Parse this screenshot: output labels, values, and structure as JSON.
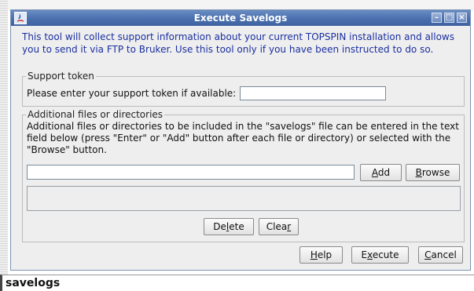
{
  "window": {
    "title": "Execute Savelogs",
    "minimize_icon": "minimize-icon",
    "maximize_icon": "maximize-icon",
    "close_icon": "close-icon"
  },
  "intro_text": "This tool will collect support information about your current TOPSPIN installation and allows you to send it via FTP to Bruker. Use this tool only if you have been instructed to do so.",
  "support_token": {
    "legend": "Support token",
    "label": "Please enter your support token if available:",
    "value": ""
  },
  "additional": {
    "legend": "Additional files or directories",
    "description": "Additional files or directories to be included in the \"savelogs\" file can be entered in the text field below (press \"Enter\" or \"Add\" button after each file or directory) or selected with the \"Browse\" button.",
    "path_value": "",
    "add": {
      "pre": "",
      "mn": "A",
      "post": "dd"
    },
    "browse": {
      "pre": "",
      "mn": "B",
      "post": "rowse"
    },
    "delete": {
      "pre": "De",
      "mn": "l",
      "post": "ete"
    },
    "clear": {
      "pre": "Clea",
      "mn": "r",
      "post": ""
    }
  },
  "footer": {
    "help": {
      "pre": "",
      "mn": "H",
      "post": "elp"
    },
    "execute": {
      "pre": "E",
      "mn": "x",
      "post": "ecute"
    },
    "cancel": {
      "pre": "",
      "mn": "C",
      "post": "ancel"
    }
  },
  "caption": "savelogs",
  "colors": {
    "title_bar": "#4a6fae",
    "intro_text": "#1b2fa0"
  }
}
